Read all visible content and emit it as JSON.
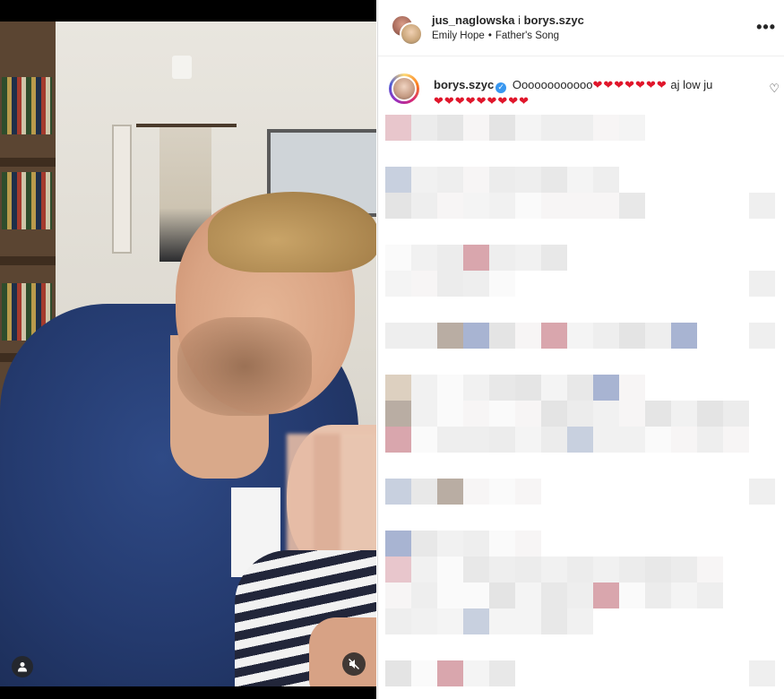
{
  "post": {
    "header": {
      "username_1": "jus_naglowska",
      "joiner": " i ",
      "username_2": "borys.szyc",
      "audio_artist": "Emily Hope",
      "audio_song": "Father's Song",
      "more_label": "•••"
    },
    "caption": {
      "username": "borys.szyc",
      "verified_mark": "✓",
      "text": "Oooooooooooo",
      "hearts_1": "❤❤❤❤❤❤❤",
      "text_2": "aj low ju",
      "hearts_2": "❤❤❤❤❤❤❤❤❤"
    },
    "like_icon": "♡"
  },
  "media": {
    "user_tag_icon": "person-icon",
    "mute_icon": "muted-speaker-icon"
  },
  "colors": {
    "verified": "#3897f0",
    "heart": "#e0162b",
    "text": "#262626"
  }
}
